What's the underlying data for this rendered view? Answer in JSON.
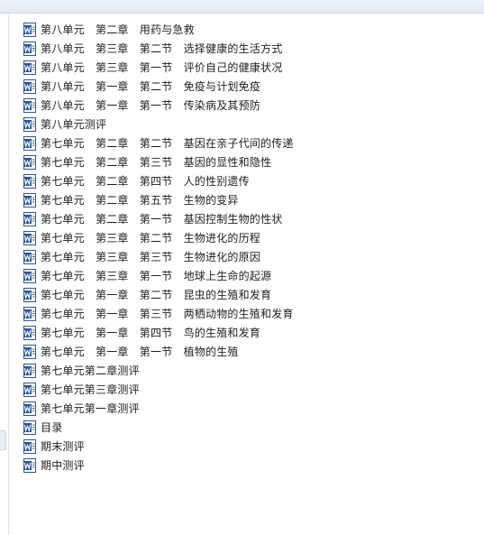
{
  "icon": "word-document-icon",
  "files": [
    "第八单元　第二章　用药与急救",
    "第八单元　第三章　第二节　选择健康的生活方式",
    "第八单元　第三章　第一节　评价自己的健康状况",
    "第八单元　第一章　第二节　免疫与计划免疫",
    "第八单元　第一章　第一节　传染病及其预防",
    "第八单元测评",
    "第七单元　第二章　第二节　基因在亲子代间的传递",
    "第七单元　第二章　第三节　基因的显性和隐性",
    "第七单元　第二章　第四节　人的性别遗传",
    "第七单元　第二章　第五节　生物的变异",
    "第七单元　第二章　第一节　基因控制生物的性状",
    "第七单元　第三章　第二节　生物进化的历程",
    "第七单元　第三章　第三节　生物进化的原因",
    "第七单元　第三章　第一节　地球上生命的起源",
    "第七单元　第一章　第二节　昆虫的生殖和发育",
    "第七单元　第一章　第三节　两栖动物的生殖和发育",
    "第七单元　第一章　第四节　鸟的生殖和发育",
    "第七单元　第一章　第一节　植物的生殖",
    "第七单元第二章测评",
    "第七单元第三章测评",
    "第七单元第一章测评",
    "目录",
    "期末测评",
    "期中测评"
  ]
}
